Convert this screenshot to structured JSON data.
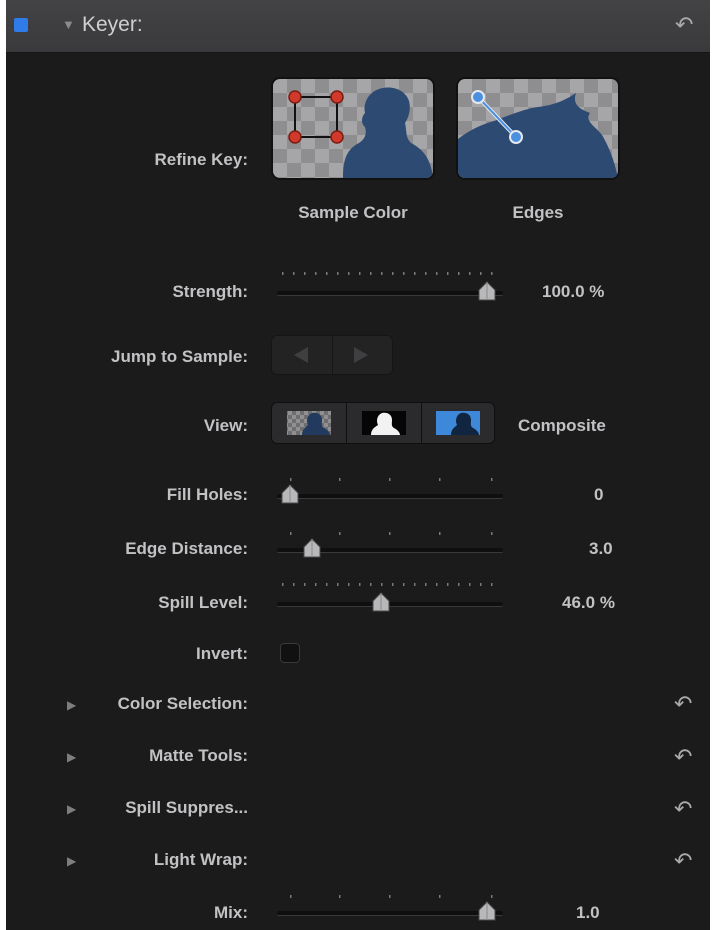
{
  "header": {
    "title": "Keyer:",
    "reset_icon": "reset-arrow-icon"
  },
  "refine_key": {
    "label": "Refine Key:",
    "buttons": [
      {
        "label": "Sample Color",
        "icon": "sample-color-icon"
      },
      {
        "label": "Edges",
        "icon": "edges-icon"
      }
    ]
  },
  "strength": {
    "label": "Strength:",
    "value": "100.0",
    "unit": "%",
    "level": 1.0
  },
  "jump": {
    "label": "Jump to Sample:",
    "prev_icon": "triangle-left-icon",
    "next_icon": "triangle-right-icon"
  },
  "view": {
    "label": "View:",
    "value": "Composite",
    "options": [
      "composite-view-icon",
      "matte-view-icon",
      "original-view-icon"
    ]
  },
  "fill_holes": {
    "label": "Fill Holes:",
    "value": "0",
    "level": 0.0
  },
  "edge_distance": {
    "label": "Edge Distance:",
    "value": "3.0",
    "level": 0.1
  },
  "spill_level": {
    "label": "Spill Level:",
    "value": "46.0",
    "unit": "%",
    "level": 0.46
  },
  "invert": {
    "label": "Invert:",
    "checked": false
  },
  "groups": [
    {
      "label": "Color Selection:"
    },
    {
      "label": "Matte Tools:"
    },
    {
      "label": "Spill Suppres..."
    },
    {
      "label": "Light Wrap:"
    }
  ],
  "mix": {
    "label": "Mix:",
    "value": "1.0",
    "level": 1.0
  },
  "colors": {
    "panel": "#1b1b1c",
    "header": "#3d3d3f",
    "accent": "#2f7be8",
    "text": "#c2c2c4"
  }
}
